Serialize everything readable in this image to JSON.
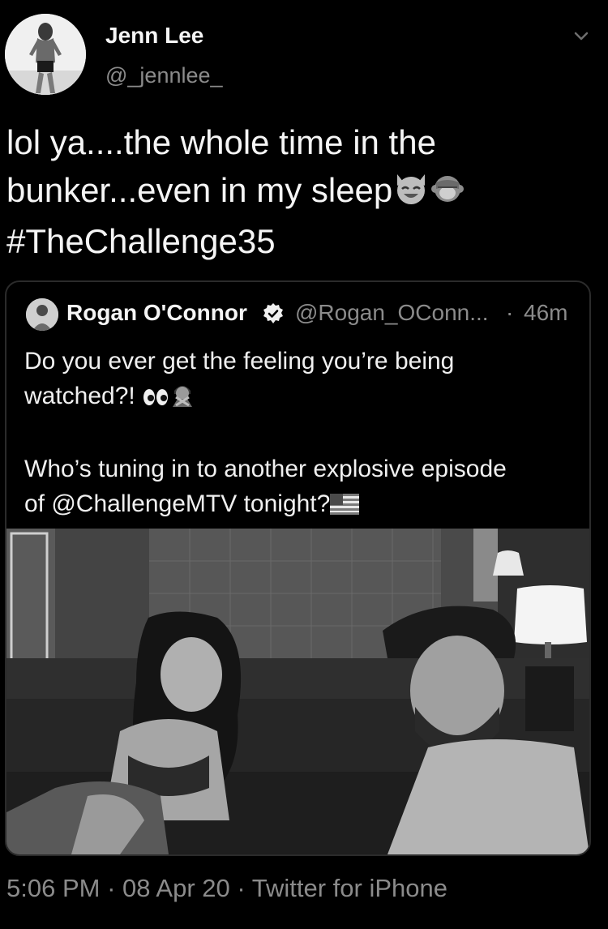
{
  "author": {
    "display_name": "Jenn Lee",
    "handle": "@_jennlee_"
  },
  "tweet": {
    "line1": "lol ya....the whole time in the",
    "line2_text": "bunker...even in my sleep",
    "hashtag": "#TheChallenge35",
    "emojis": [
      "smiling-cat-icon",
      "see-no-evil-monkey-icon"
    ]
  },
  "quoted_tweet": {
    "display_name": "Rogan O'Connor",
    "verified": true,
    "handle": "@Rogan_OConn...",
    "separator": "·",
    "time": "46m",
    "line1": "Do you ever get the feeling you’re being",
    "line2": "watched?!",
    "line2_emojis": [
      "eyes-icon",
      "person-gesturing-no-icon"
    ],
    "line4": "Who’s tuning in to another explosive episode",
    "line5": "of @ChallengeMTV tonight?",
    "line5_emoji": "us-flag-icon"
  },
  "footer": {
    "time": "5:06 PM",
    "sep1": "·",
    "date": "08 Apr 20",
    "sep2": "·",
    "source": "Twitter for iPhone"
  },
  "colors": {
    "background": "#000000",
    "text": "#f5f5f5",
    "secondary": "#8b8b8b",
    "border": "#2b2b2b"
  }
}
